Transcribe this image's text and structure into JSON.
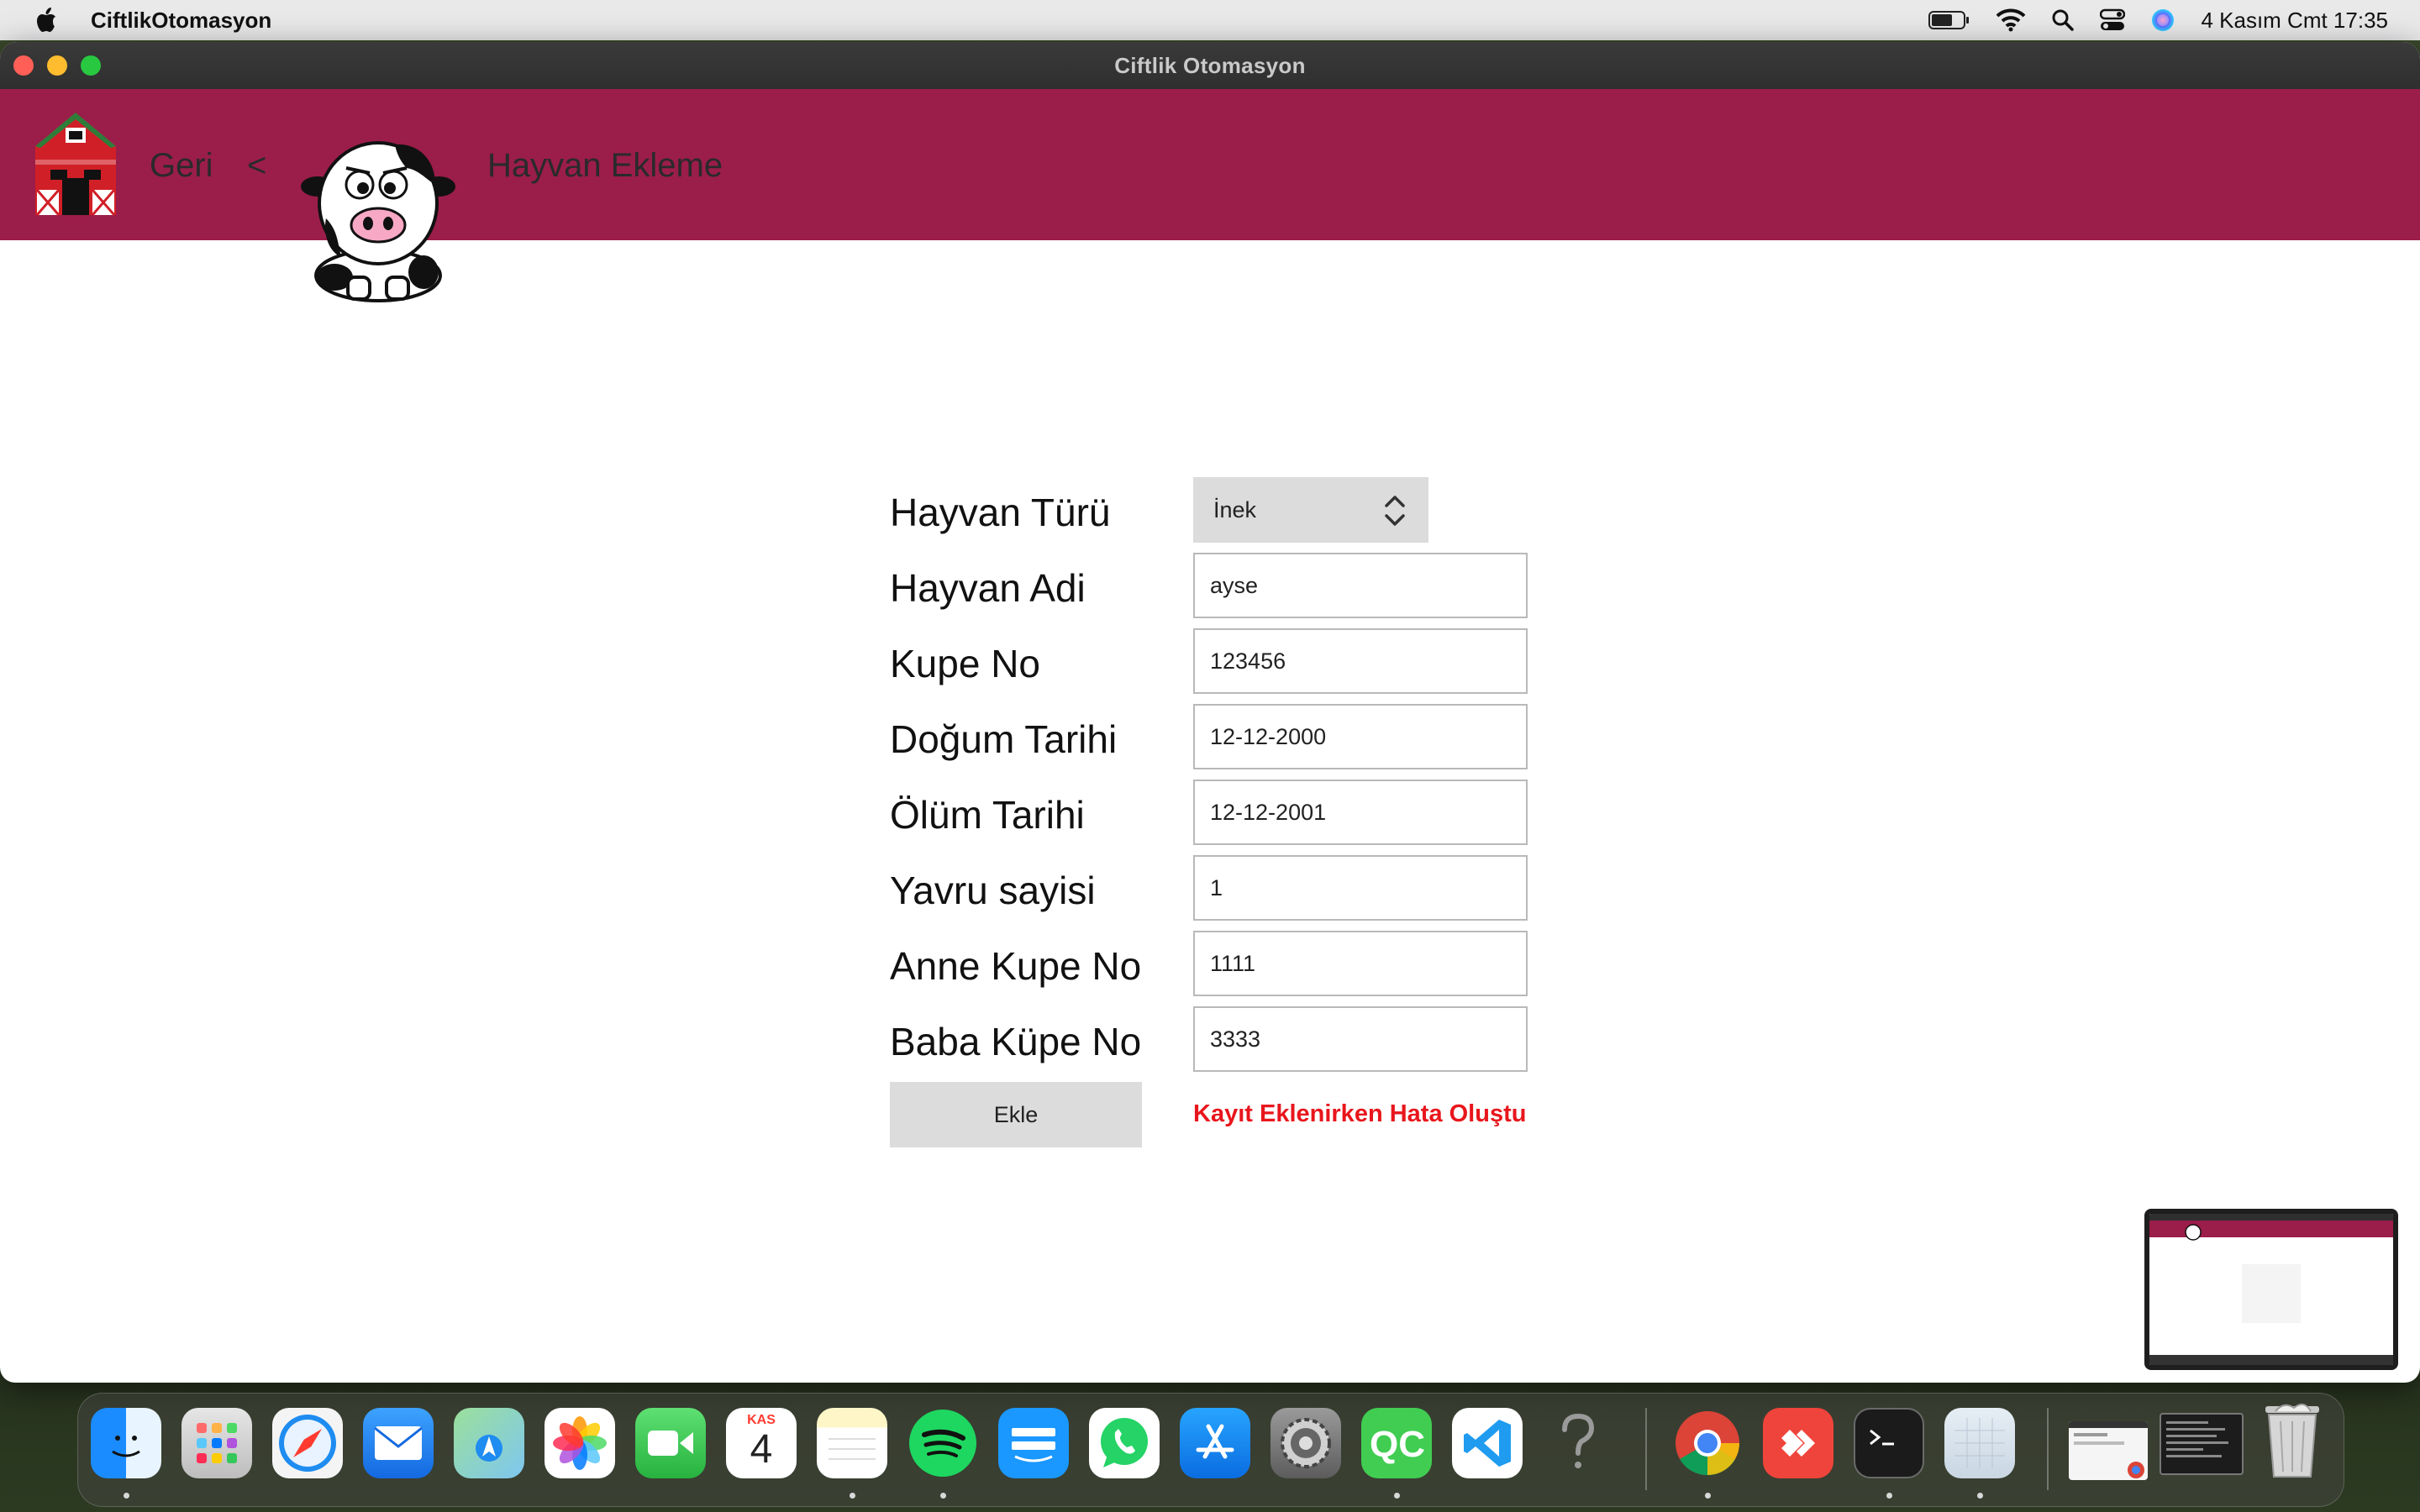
{
  "menubar": {
    "app_name": "CiftlikOtomasyon",
    "datetime": "4 Kasım Cmt  17:35"
  },
  "window": {
    "title": "Ciftlik Otomasyon"
  },
  "header": {
    "back_label": "Geri",
    "separator": "<",
    "page_title": "Hayvan Ekleme"
  },
  "form": {
    "species_label": "Hayvan Türü",
    "species_value": "İnek",
    "name_label": "Hayvan Adi",
    "name_value": "ayse",
    "tag_label": "Kupe No",
    "tag_value": "123456",
    "birth_label": "Doğum Tarihi",
    "birth_value": "12-12-2000",
    "death_label": "Ölüm Tarihi",
    "death_value": "12-12-2001",
    "offspring_label": "Yavru sayisi",
    "offspring_value": "1",
    "mother_label": "Anne Kupe No",
    "mother_value": "1111",
    "father_label": "Baba Küpe No",
    "father_value": "3333",
    "submit_label": "Ekle",
    "error_message": "Kayıt Eklenirken Hata Oluştu",
    "error_color": "#e8161c"
  },
  "theme": {
    "header_color": "#9b1d4a"
  },
  "dock": {
    "calendar_month": "KAS",
    "calendar_day": "4",
    "items": [
      "finder-icon",
      "launchpad-icon",
      "safari-icon",
      "mail-icon",
      "maps-icon",
      "photos-icon",
      "facetime-icon",
      "calendar-icon",
      "notes-icon",
      "spotify-icon",
      "prime-video-icon",
      "whatsapp-icon",
      "app-store-icon",
      "system-settings-icon",
      "qt-creator-icon",
      "vscode-icon",
      "help-icon",
      "chrome-icon",
      "anydesk-icon",
      "terminal-icon",
      "preview-icon",
      "downloads-stack-icon",
      "documents-stack-icon",
      "trash-icon"
    ]
  }
}
